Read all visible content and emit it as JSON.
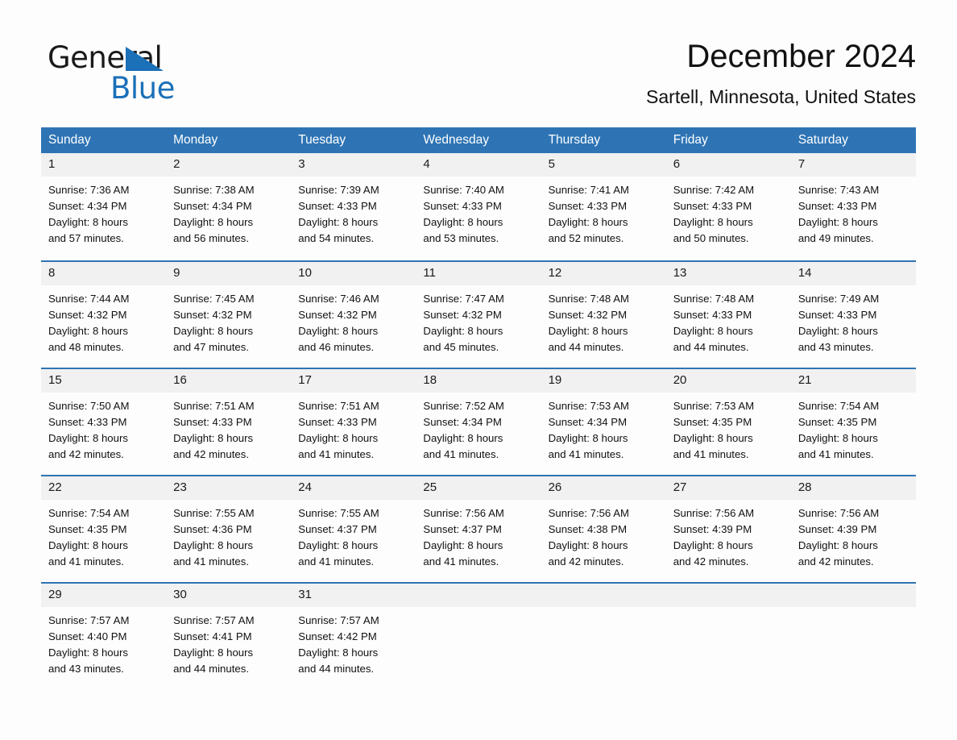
{
  "brand": {
    "line1": "General",
    "line2": "Blue",
    "triangle_color": "#1b70b8"
  },
  "header": {
    "title": "December 2024",
    "subtitle": "Sartell, Minnesota, United States"
  },
  "colors": {
    "header_blue": "#2e74b5",
    "daynum_gray": "#f1f1f1",
    "text": "#111111",
    "page_bg": "#fdfdfd"
  },
  "calendar": {
    "weekday_headers": [
      "Sunday",
      "Monday",
      "Tuesday",
      "Wednesday",
      "Thursday",
      "Friday",
      "Saturday"
    ],
    "weeks": [
      [
        {
          "day": "1",
          "sunrise": "Sunrise: 7:36 AM",
          "sunset": "Sunset: 4:34 PM",
          "daylight_1": "Daylight: 8 hours",
          "daylight_2": "and 57 minutes."
        },
        {
          "day": "2",
          "sunrise": "Sunrise: 7:38 AM",
          "sunset": "Sunset: 4:34 PM",
          "daylight_1": "Daylight: 8 hours",
          "daylight_2": "and 56 minutes."
        },
        {
          "day": "3",
          "sunrise": "Sunrise: 7:39 AM",
          "sunset": "Sunset: 4:33 PM",
          "daylight_1": "Daylight: 8 hours",
          "daylight_2": "and 54 minutes."
        },
        {
          "day": "4",
          "sunrise": "Sunrise: 7:40 AM",
          "sunset": "Sunset: 4:33 PM",
          "daylight_1": "Daylight: 8 hours",
          "daylight_2": "and 53 minutes."
        },
        {
          "day": "5",
          "sunrise": "Sunrise: 7:41 AM",
          "sunset": "Sunset: 4:33 PM",
          "daylight_1": "Daylight: 8 hours",
          "daylight_2": "and 52 minutes."
        },
        {
          "day": "6",
          "sunrise": "Sunrise: 7:42 AM",
          "sunset": "Sunset: 4:33 PM",
          "daylight_1": "Daylight: 8 hours",
          "daylight_2": "and 50 minutes."
        },
        {
          "day": "7",
          "sunrise": "Sunrise: 7:43 AM",
          "sunset": "Sunset: 4:33 PM",
          "daylight_1": "Daylight: 8 hours",
          "daylight_2": "and 49 minutes."
        }
      ],
      [
        {
          "day": "8",
          "sunrise": "Sunrise: 7:44 AM",
          "sunset": "Sunset: 4:32 PM",
          "daylight_1": "Daylight: 8 hours",
          "daylight_2": "and 48 minutes."
        },
        {
          "day": "9",
          "sunrise": "Sunrise: 7:45 AM",
          "sunset": "Sunset: 4:32 PM",
          "daylight_1": "Daylight: 8 hours",
          "daylight_2": "and 47 minutes."
        },
        {
          "day": "10",
          "sunrise": "Sunrise: 7:46 AM",
          "sunset": "Sunset: 4:32 PM",
          "daylight_1": "Daylight: 8 hours",
          "daylight_2": "and 46 minutes."
        },
        {
          "day": "11",
          "sunrise": "Sunrise: 7:47 AM",
          "sunset": "Sunset: 4:32 PM",
          "daylight_1": "Daylight: 8 hours",
          "daylight_2": "and 45 minutes."
        },
        {
          "day": "12",
          "sunrise": "Sunrise: 7:48 AM",
          "sunset": "Sunset: 4:32 PM",
          "daylight_1": "Daylight: 8 hours",
          "daylight_2": "and 44 minutes."
        },
        {
          "day": "13",
          "sunrise": "Sunrise: 7:48 AM",
          "sunset": "Sunset: 4:33 PM",
          "daylight_1": "Daylight: 8 hours",
          "daylight_2": "and 44 minutes."
        },
        {
          "day": "14",
          "sunrise": "Sunrise: 7:49 AM",
          "sunset": "Sunset: 4:33 PM",
          "daylight_1": "Daylight: 8 hours",
          "daylight_2": "and 43 minutes."
        }
      ],
      [
        {
          "day": "15",
          "sunrise": "Sunrise: 7:50 AM",
          "sunset": "Sunset: 4:33 PM",
          "daylight_1": "Daylight: 8 hours",
          "daylight_2": "and 42 minutes."
        },
        {
          "day": "16",
          "sunrise": "Sunrise: 7:51 AM",
          "sunset": "Sunset: 4:33 PM",
          "daylight_1": "Daylight: 8 hours",
          "daylight_2": "and 42 minutes."
        },
        {
          "day": "17",
          "sunrise": "Sunrise: 7:51 AM",
          "sunset": "Sunset: 4:33 PM",
          "daylight_1": "Daylight: 8 hours",
          "daylight_2": "and 41 minutes."
        },
        {
          "day": "18",
          "sunrise": "Sunrise: 7:52 AM",
          "sunset": "Sunset: 4:34 PM",
          "daylight_1": "Daylight: 8 hours",
          "daylight_2": "and 41 minutes."
        },
        {
          "day": "19",
          "sunrise": "Sunrise: 7:53 AM",
          "sunset": "Sunset: 4:34 PM",
          "daylight_1": "Daylight: 8 hours",
          "daylight_2": "and 41 minutes."
        },
        {
          "day": "20",
          "sunrise": "Sunrise: 7:53 AM",
          "sunset": "Sunset: 4:35 PM",
          "daylight_1": "Daylight: 8 hours",
          "daylight_2": "and 41 minutes."
        },
        {
          "day": "21",
          "sunrise": "Sunrise: 7:54 AM",
          "sunset": "Sunset: 4:35 PM",
          "daylight_1": "Daylight: 8 hours",
          "daylight_2": "and 41 minutes."
        }
      ],
      [
        {
          "day": "22",
          "sunrise": "Sunrise: 7:54 AM",
          "sunset": "Sunset: 4:35 PM",
          "daylight_1": "Daylight: 8 hours",
          "daylight_2": "and 41 minutes."
        },
        {
          "day": "23",
          "sunrise": "Sunrise: 7:55 AM",
          "sunset": "Sunset: 4:36 PM",
          "daylight_1": "Daylight: 8 hours",
          "daylight_2": "and 41 minutes."
        },
        {
          "day": "24",
          "sunrise": "Sunrise: 7:55 AM",
          "sunset": "Sunset: 4:37 PM",
          "daylight_1": "Daylight: 8 hours",
          "daylight_2": "and 41 minutes."
        },
        {
          "day": "25",
          "sunrise": "Sunrise: 7:56 AM",
          "sunset": "Sunset: 4:37 PM",
          "daylight_1": "Daylight: 8 hours",
          "daylight_2": "and 41 minutes."
        },
        {
          "day": "26",
          "sunrise": "Sunrise: 7:56 AM",
          "sunset": "Sunset: 4:38 PM",
          "daylight_1": "Daylight: 8 hours",
          "daylight_2": "and 42 minutes."
        },
        {
          "day": "27",
          "sunrise": "Sunrise: 7:56 AM",
          "sunset": "Sunset: 4:39 PM",
          "daylight_1": "Daylight: 8 hours",
          "daylight_2": "and 42 minutes."
        },
        {
          "day": "28",
          "sunrise": "Sunrise: 7:56 AM",
          "sunset": "Sunset: 4:39 PM",
          "daylight_1": "Daylight: 8 hours",
          "daylight_2": "and 42 minutes."
        }
      ],
      [
        {
          "day": "29",
          "sunrise": "Sunrise: 7:57 AM",
          "sunset": "Sunset: 4:40 PM",
          "daylight_1": "Daylight: 8 hours",
          "daylight_2": "and 43 minutes."
        },
        {
          "day": "30",
          "sunrise": "Sunrise: 7:57 AM",
          "sunset": "Sunset: 4:41 PM",
          "daylight_1": "Daylight: 8 hours",
          "daylight_2": "and 44 minutes."
        },
        {
          "day": "31",
          "sunrise": "Sunrise: 7:57 AM",
          "sunset": "Sunset: 4:42 PM",
          "daylight_1": "Daylight: 8 hours",
          "daylight_2": "and 44 minutes."
        },
        {
          "day": "",
          "sunrise": "",
          "sunset": "",
          "daylight_1": "",
          "daylight_2": ""
        },
        {
          "day": "",
          "sunrise": "",
          "sunset": "",
          "daylight_1": "",
          "daylight_2": ""
        },
        {
          "day": "",
          "sunrise": "",
          "sunset": "",
          "daylight_1": "",
          "daylight_2": ""
        },
        {
          "day": "",
          "sunrise": "",
          "sunset": "",
          "daylight_1": "",
          "daylight_2": ""
        }
      ]
    ]
  }
}
